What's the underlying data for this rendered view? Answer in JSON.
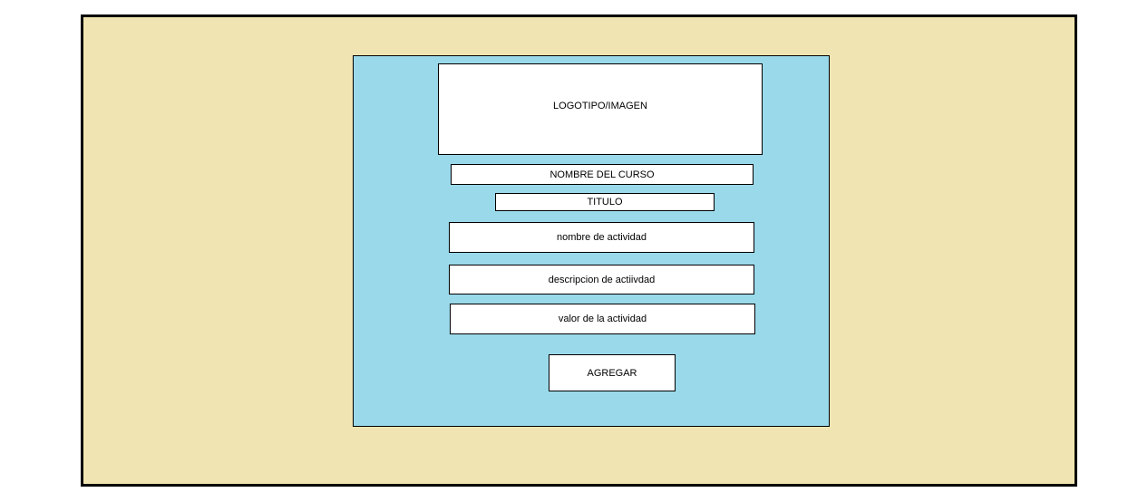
{
  "colors": {
    "outer_background": "#f0e4b2",
    "panel_background": "#9ad9ea",
    "box_background": "#ffffff",
    "border": "#000000"
  },
  "form": {
    "logo_label": "LOGOTIPO/IMAGEN",
    "course_name_label": "NOMBRE DEL CURSO",
    "title_label": "TITULO",
    "activity_name_placeholder": "nombre de actividad",
    "activity_description_placeholder": "descripcion de actiivdad",
    "activity_value_placeholder": "valor de la actividad",
    "add_button_label": "AGREGAR"
  }
}
